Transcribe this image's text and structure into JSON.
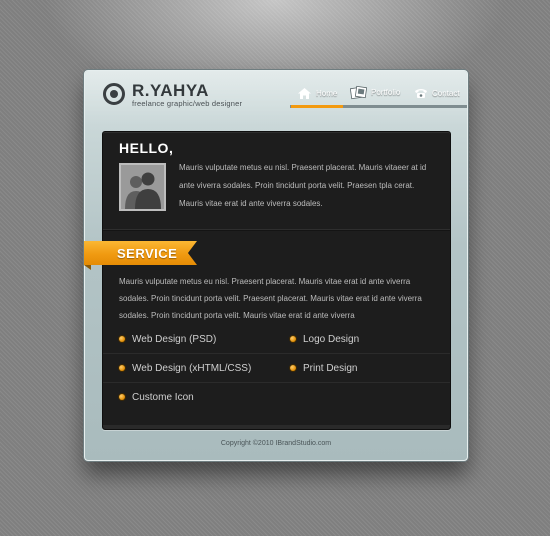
{
  "brand": {
    "name": "R.YAHYA",
    "tagline": "freelance graphic/web designer"
  },
  "nav": {
    "items": [
      {
        "label": "Home",
        "icon": "home-icon"
      },
      {
        "label": "Portfolio",
        "icon": "portfolio-icon"
      },
      {
        "label": "Contact",
        "icon": "phone-icon"
      }
    ],
    "active": "Home"
  },
  "intro": {
    "heading": "HELLO,",
    "text": "Mauris vulputate metus eu nisl. Praesent placerat. Mauris vitaeer at id ante viverra sodales. Proin tincidunt porta velit. Praesen tpla cerat. Mauris vitae erat id ante viverra sodales."
  },
  "service": {
    "heading": "SERVICE",
    "text": "Mauris vulputate metus eu nisl. Praesent placerat. Mauris vitae erat id ante viverra sodales. Proin tincidunt porta velit. Praesent placerat. Mauris vitae erat id ante viverra sodales. Proin tincidunt porta velit. Mauris vitae erat id ante viverra",
    "items": [
      "Web Design (PSD)",
      "Logo Design",
      "Web Design (xHTML/CSS)",
      "Print Design",
      "Custome Icon"
    ]
  },
  "footer": {
    "copyright": "Copyright ©2010 IBrandStudio.com"
  },
  "colors": {
    "accent": "#f39a0f",
    "panel": "#1d1d1d",
    "frame": "#b3c4c6"
  }
}
